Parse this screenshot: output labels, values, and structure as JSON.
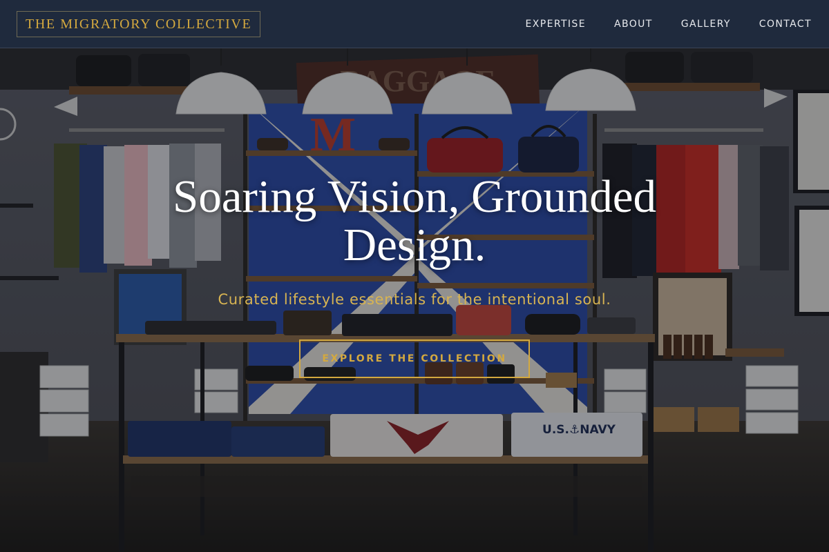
{
  "brand": {
    "name": "THE MIGRATORY COLLECTIVE"
  },
  "nav": {
    "items": [
      {
        "label": "EXPERTISE"
      },
      {
        "label": "ABOUT"
      },
      {
        "label": "GALLERY"
      },
      {
        "label": "CONTACT"
      }
    ]
  },
  "hero": {
    "title": "Soaring Vision, Grounded Design.",
    "subtitle": "Curated lifestyle essentials for the intentional soul.",
    "cta_label": "EXPLORE THE COLLECTION",
    "background": {
      "sign_text": "BAGGAGE",
      "letter_text": "M",
      "shirt_text": "U.S.⚓NAVY"
    }
  },
  "colors": {
    "accent": "#d4a93f",
    "nav_bg": "#1f2a3d",
    "title": "#ffffff"
  }
}
